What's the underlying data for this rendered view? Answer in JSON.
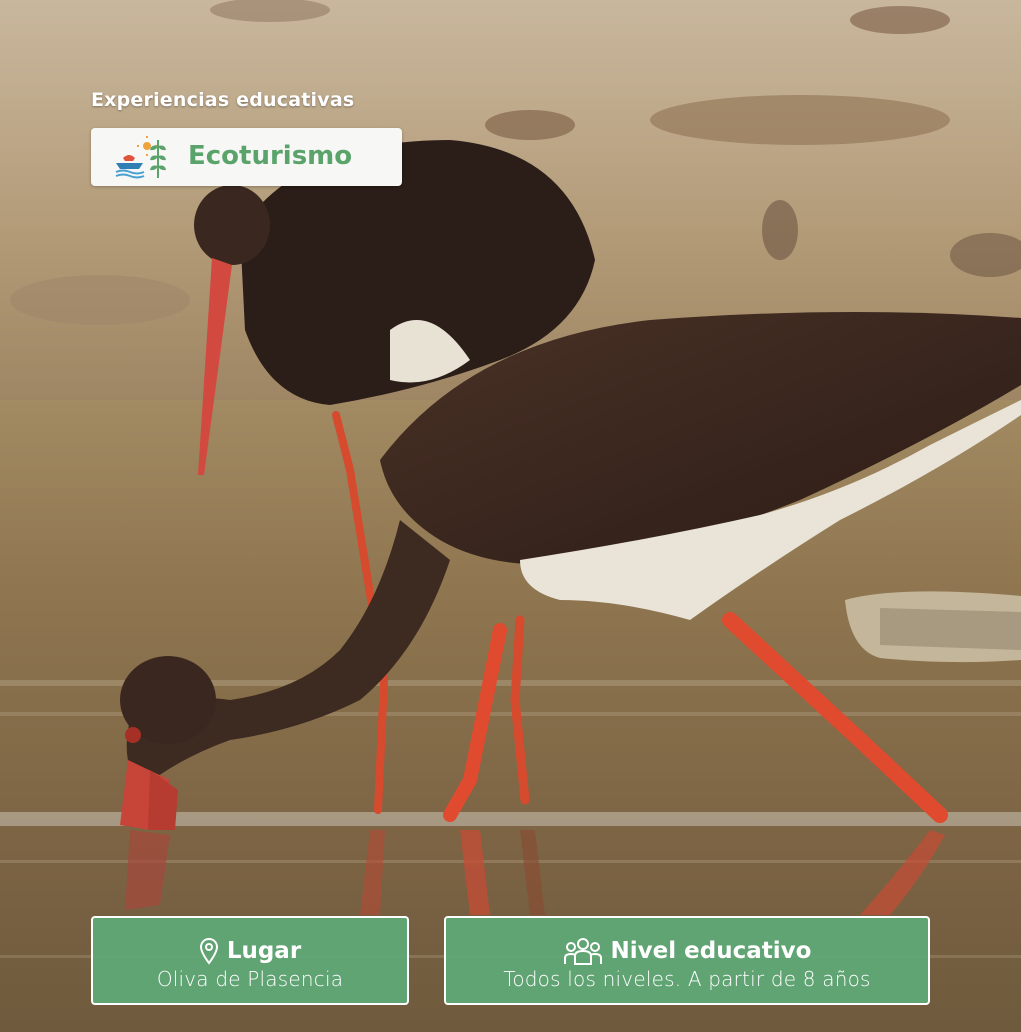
{
  "header": {
    "kicker": "Experiencias educativas",
    "category": "Ecoturismo",
    "category_icon": "ecotourism-icon"
  },
  "info_cards": [
    {
      "icon": "location-pin-icon",
      "title": "Lugar",
      "value": "Oliva de Plasencia"
    },
    {
      "icon": "group-people-icon",
      "title": "Nivel educativo",
      "value": "Todos los niveles. A partir de 8 años"
    }
  ],
  "colors": {
    "accent_green": "#5aa36a",
    "card_green": "#60aa78"
  }
}
